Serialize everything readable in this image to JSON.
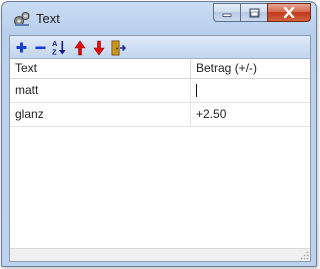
{
  "window": {
    "title": "Text"
  },
  "toolbar": {
    "buttons": [
      {
        "icon": "plus-icon",
        "label": "+",
        "color": "#1a3fcf"
      },
      {
        "icon": "minus-icon",
        "label": "−",
        "color": "#1a3fcf"
      },
      {
        "icon": "sort-az-icon",
        "label": "A Z"
      },
      {
        "icon": "arrow-up-icon",
        "color": "#e01010"
      },
      {
        "icon": "arrow-down-icon",
        "color": "#e01010"
      },
      {
        "icon": "exit-door-icon",
        "color": "#c89a16"
      }
    ]
  },
  "table": {
    "columns": [
      "Text",
      "Betrag (+/-)"
    ],
    "rows": [
      {
        "text": "matt",
        "betrag": ""
      },
      {
        "text": "glanz",
        "betrag": "+2.50"
      }
    ]
  }
}
